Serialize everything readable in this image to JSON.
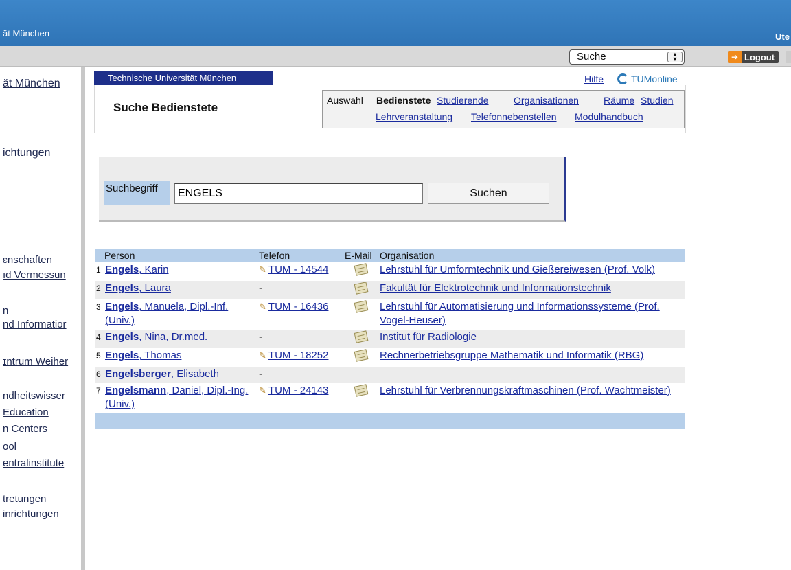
{
  "topbar": {
    "institution": "ät München",
    "user": "Ute"
  },
  "toolbar": {
    "select_value": "Suche",
    "select_arrows": "▲▼",
    "logout": "Logout"
  },
  "sidebar": {
    "items": [
      "ät München",
      "ichtungen",
      "ɛnschaften",
      "ıd Vermessun",
      "n",
      "nd Informatior",
      "ɪntrum Weiher",
      "ndheitswisser",
      "Education",
      "n Centers",
      "ool",
      "entralinstitute",
      "tretungen",
      "inrichtungen"
    ]
  },
  "header": {
    "breadcrumb": "Technische Universität München",
    "help": "Hilfe",
    "brand": "TUMonline",
    "title": "Suche Bedienstete"
  },
  "nav": {
    "label": "Auswahl",
    "current": "Bedienstete",
    "links": [
      "Studierende",
      "Organisationen",
      "Räume",
      "Studien",
      "Lehrveranstaltung",
      "Telefonnebenstellen",
      "Modulhandbuch"
    ]
  },
  "search": {
    "label": "Suchbegriff",
    "value": "ENGELS",
    "button": "Suchen"
  },
  "results": {
    "columns": [
      "Person",
      "Telefon",
      "E-Mail",
      "Organisation"
    ],
    "rows": [
      {
        "n": "1",
        "last": "Engels",
        "first": ", Karin",
        "tel": "TUM - 14544",
        "org": "Lehrstuhl für Umformtechnik und Gießereiwesen (Prof. Volk)"
      },
      {
        "n": "2",
        "last": "Engels",
        "first": ", Laura",
        "tel": "-",
        "org": "Fakultät für Elektrotechnik und Informationstechnik"
      },
      {
        "n": "3",
        "last": "Engels",
        "first": ", Manuela, Dipl.-Inf. (Univ.)",
        "tel": "TUM - 16436",
        "org": "Lehrstuhl für Automatisierung und Informationssysteme (Prof. Vogel-Heuser)"
      },
      {
        "n": "4",
        "last": "Engels",
        "first": ", Nina, Dr.med.",
        "tel": "-",
        "org": "Institut für Radiologie"
      },
      {
        "n": "5",
        "last": "Engels",
        "first": ", Thomas",
        "tel": "TUM - 18252",
        "org": "Rechnerbetriebsgruppe Mathematik und Informatik (RBG)"
      },
      {
        "n": "6",
        "last": "Engelsberger",
        "first": ", Elisabeth",
        "tel": "-",
        "org": ""
      },
      {
        "n": "7",
        "last": "Engelsmann",
        "first": ", Daniel, Dipl.-Ing. (Univ.)",
        "tel": "TUM - 24143",
        "org": "Lehrstuhl für Verbrennungskraftmaschinen (Prof. Wachtmeister)"
      }
    ]
  }
}
